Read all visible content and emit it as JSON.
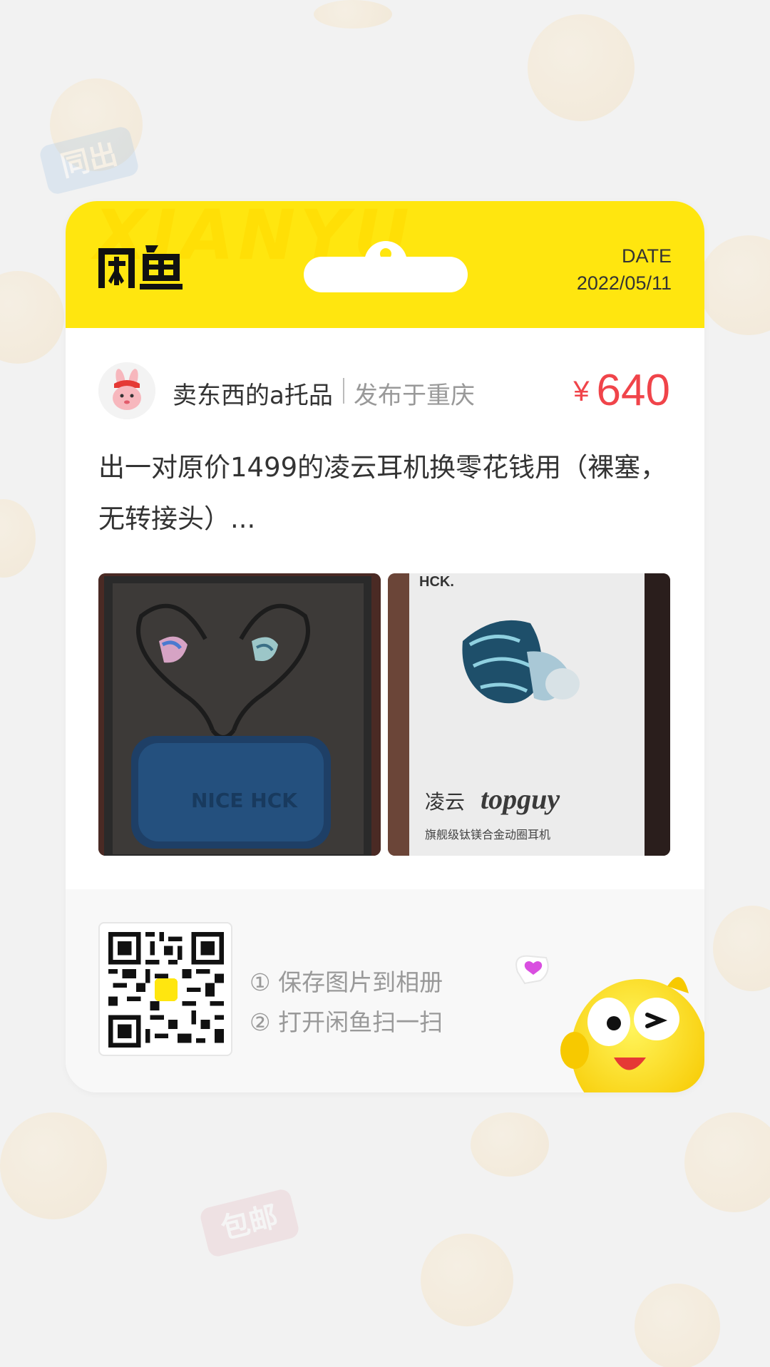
{
  "header": {
    "watermark": "XIANYU",
    "logo_text": "闲鱼",
    "date_label": "DATE",
    "date_value": "2022/05/11"
  },
  "seller": {
    "name": "卖东西的a托品",
    "location": "发布于重庆",
    "avatar_icon": "rabbit-avatar-icon"
  },
  "price": {
    "currency": "¥",
    "amount": "640"
  },
  "description": "出一对原价1499的凌云耳机换零花钱用（裸塞，无转接头）...",
  "photos": [
    {
      "label": "earphones-in-case-photo"
    },
    {
      "label": "earphone-box-photo",
      "box_brand": "HCK.",
      "box_name": "凌云",
      "box_model": "topguy",
      "box_subtitle": "旗舰级钛镁合金动圈耳机"
    }
  ],
  "footer": {
    "qr_badge": "闲鱼",
    "step1": "① 保存图片到相册",
    "step2": "② 打开闲鱼扫一扫"
  },
  "background": {
    "tag1": "同出",
    "tag2": "包邮"
  },
  "colors": {
    "header": "#ffe60f",
    "price": "#f0444a",
    "page_bg": "#f2f2f2"
  }
}
